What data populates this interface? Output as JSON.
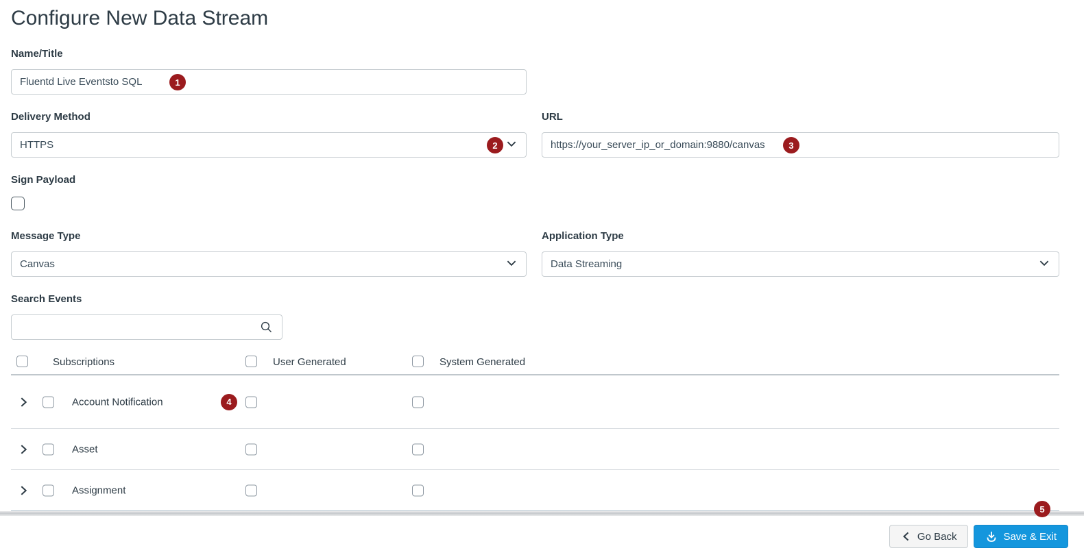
{
  "page_title": "Configure New Data Stream",
  "fields": {
    "name_title": {
      "label": "Name/Title",
      "value": "Fluentd Live Eventsto SQL"
    },
    "delivery_method": {
      "label": "Delivery Method",
      "value": "HTTPS"
    },
    "url": {
      "label": "URL",
      "value": "https://your_server_ip_or_domain:9880/canvas"
    },
    "sign_payload": {
      "label": "Sign Payload",
      "checked": false
    },
    "message_type": {
      "label": "Message Type",
      "value": "Canvas"
    },
    "application_type": {
      "label": "Application Type",
      "value": "Data Streaming"
    },
    "search_events": {
      "label": "Search Events",
      "value": ""
    }
  },
  "events_table": {
    "header": {
      "subscriptions": "Subscriptions",
      "user_generated": "User Generated",
      "system_generated": "System Generated"
    },
    "rows": [
      {
        "label": "Account Notification",
        "expanded": false,
        "subscribed": false,
        "user_generated": false,
        "system_generated": false
      },
      {
        "label": "Asset",
        "expanded": false,
        "subscribed": false,
        "user_generated": false,
        "system_generated": false
      },
      {
        "label": "Assignment",
        "expanded": false,
        "subscribed": false,
        "user_generated": false,
        "system_generated": false
      }
    ]
  },
  "annotations": {
    "badges": [
      "1",
      "2",
      "3",
      "4",
      "5"
    ],
    "badge_color": "#9B1B1E"
  },
  "footer": {
    "go_back": "Go Back",
    "save_exit": "Save & Exit"
  },
  "colors": {
    "text": "#2D3B45",
    "input_border": "#C7CDD1",
    "primary_button": "#1496DD",
    "badge_red": "#9B1B1E"
  }
}
